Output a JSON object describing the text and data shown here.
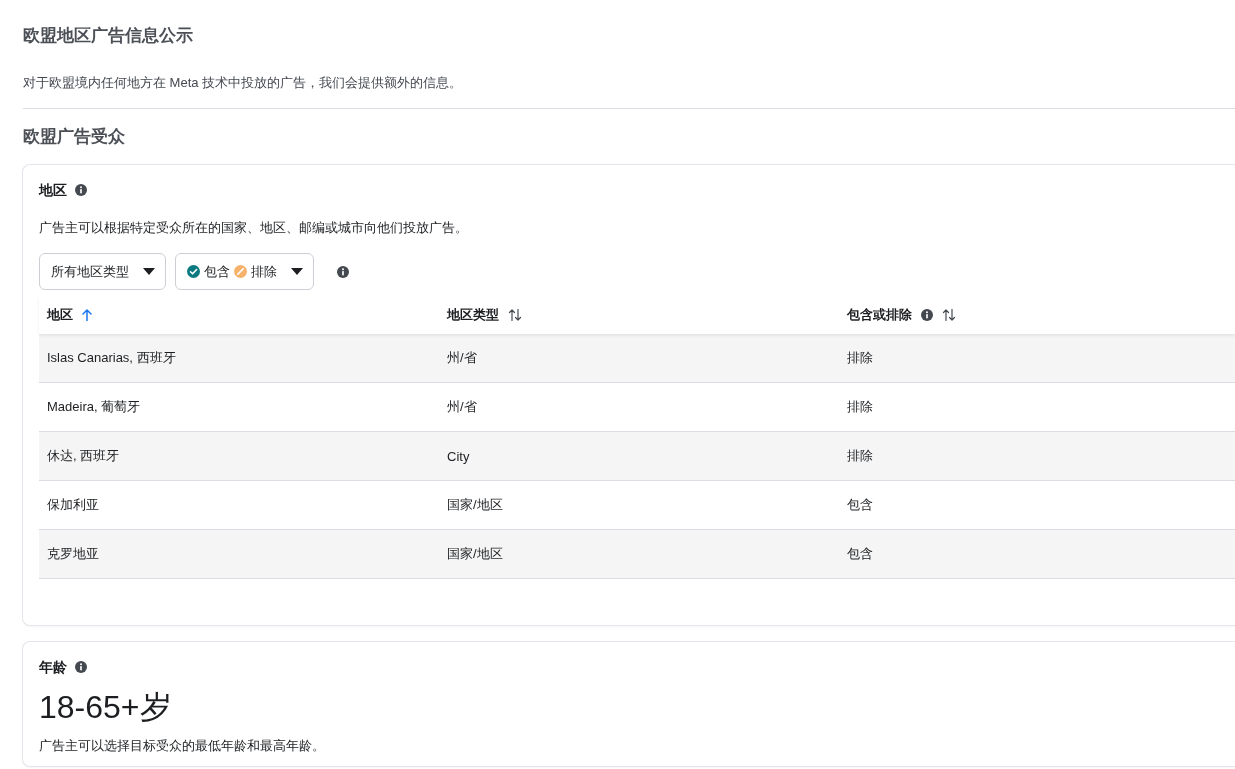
{
  "page": {
    "title": "欧盟地区广告信息公示",
    "description": "对于欧盟境内任何地方在 Meta 技术中投放的广告，我们会提供额外的信息。"
  },
  "section": {
    "title": "欧盟广告受众"
  },
  "location_card": {
    "title": "地区",
    "description": "广告主可以根据特定受众所在的国家、地区、邮编或城市向他们投放广告。",
    "filters": [
      {
        "kind": "select",
        "label": "所有地区类型"
      },
      {
        "kind": "legend",
        "items": [
          {
            "kind": "include",
            "label": "包含"
          },
          {
            "kind": "exclude",
            "label": "排除"
          }
        ]
      }
    ],
    "table": {
      "columns": [
        {
          "label": "地区",
          "sorted": true,
          "info": false
        },
        {
          "label": "地区类型",
          "sorted": false,
          "info": false
        },
        {
          "label": "包含或排除",
          "sorted": false,
          "info": true
        }
      ],
      "rows": [
        [
          "Islas Canarias, 西班牙",
          "州/省",
          "排除"
        ],
        [
          "Madeira, 葡萄牙",
          "州/省",
          "排除"
        ],
        [
          "休达, 西班牙",
          "City",
          "排除"
        ],
        [
          "保加利亚",
          "国家/地区",
          "包含"
        ],
        [
          "克罗地亚",
          "国家/地区",
          "包含"
        ]
      ]
    }
  },
  "age_card": {
    "title": "年龄",
    "value": "18-65+岁",
    "description": "广告主可以选择目标受众的最低年龄和最高年龄。"
  }
}
